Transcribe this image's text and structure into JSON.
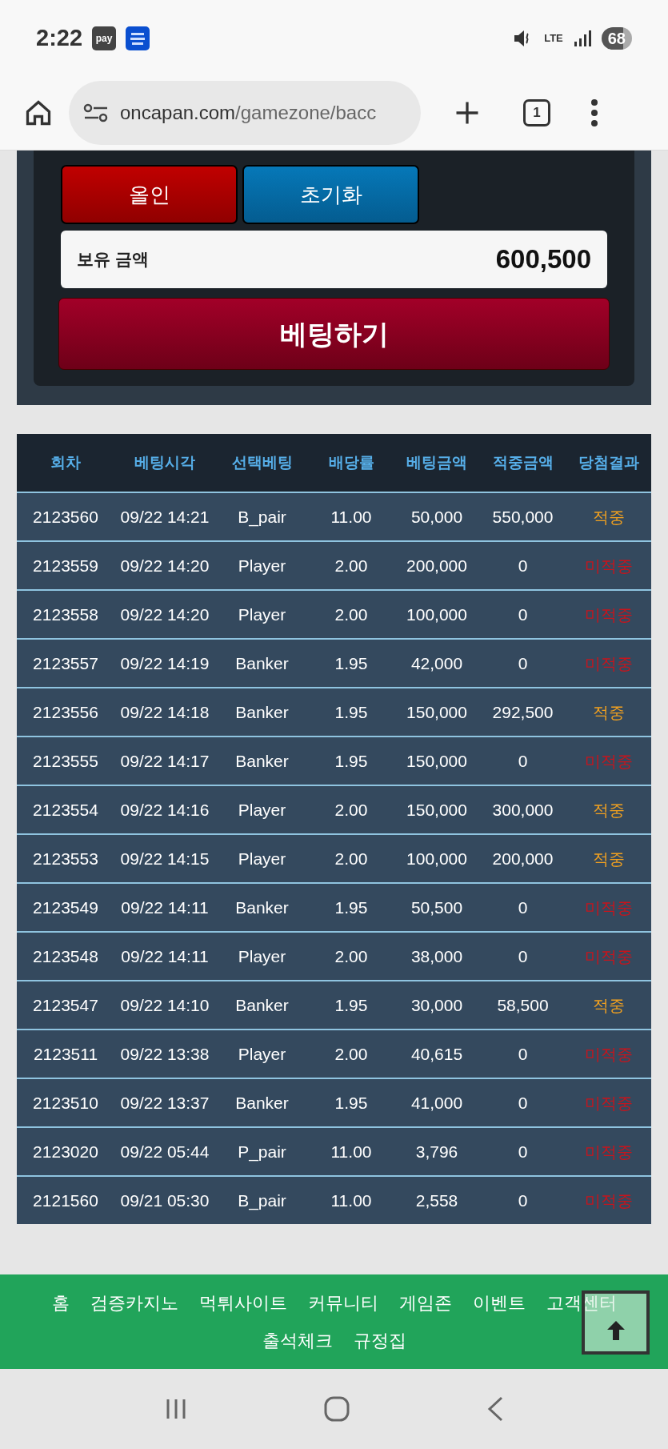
{
  "status_bar": {
    "time": "2:22",
    "pay_badge": "pay",
    "network": "LTE",
    "battery": "68"
  },
  "browser": {
    "domain": "oncapan.com",
    "path": "/gamezone/bacc",
    "tab_count": "1"
  },
  "bet_panel": {
    "all_in_button": "올인",
    "reset_button": "초기화",
    "balance_label": "보유 금액",
    "balance_value": "600,500",
    "bet_button": "베팅하기"
  },
  "table": {
    "columns": [
      "회차",
      "베팅시각",
      "선택베팅",
      "배당률",
      "베팅금액",
      "적중금액",
      "당첨결과"
    ],
    "rows": [
      {
        "cells": [
          "2123560",
          "09/22 14:21",
          "B_pair",
          "11.00",
          "50,000",
          "550,000"
        ],
        "result": "적중",
        "won": true
      },
      {
        "cells": [
          "2123559",
          "09/22 14:20",
          "Player",
          "2.00",
          "200,000",
          "0"
        ],
        "result": "미적중",
        "won": false
      },
      {
        "cells": [
          "2123558",
          "09/22 14:20",
          "Player",
          "2.00",
          "100,000",
          "0"
        ],
        "result": "미적중",
        "won": false
      },
      {
        "cells": [
          "2123557",
          "09/22 14:19",
          "Banker",
          "1.95",
          "42,000",
          "0"
        ],
        "result": "미적중",
        "won": false
      },
      {
        "cells": [
          "2123556",
          "09/22 14:18",
          "Banker",
          "1.95",
          "150,000",
          "292,500"
        ],
        "result": "적중",
        "won": true
      },
      {
        "cells": [
          "2123555",
          "09/22 14:17",
          "Banker",
          "1.95",
          "150,000",
          "0"
        ],
        "result": "미적중",
        "won": false
      },
      {
        "cells": [
          "2123554",
          "09/22 14:16",
          "Player",
          "2.00",
          "150,000",
          "300,000"
        ],
        "result": "적중",
        "won": true
      },
      {
        "cells": [
          "2123553",
          "09/22 14:15",
          "Player",
          "2.00",
          "100,000",
          "200,000"
        ],
        "result": "적중",
        "won": true
      },
      {
        "cells": [
          "2123549",
          "09/22 14:11",
          "Banker",
          "1.95",
          "50,500",
          "0"
        ],
        "result": "미적중",
        "won": false
      },
      {
        "cells": [
          "2123548",
          "09/22 14:11",
          "Player",
          "2.00",
          "38,000",
          "0"
        ],
        "result": "미적중",
        "won": false
      },
      {
        "cells": [
          "2123547",
          "09/22 14:10",
          "Banker",
          "1.95",
          "30,000",
          "58,500"
        ],
        "result": "적중",
        "won": true
      },
      {
        "cells": [
          "2123511",
          "09/22 13:38",
          "Player",
          "2.00",
          "40,615",
          "0"
        ],
        "result": "미적중",
        "won": false
      },
      {
        "cells": [
          "2123510",
          "09/22 13:37",
          "Banker",
          "1.95",
          "41,000",
          "0"
        ],
        "result": "미적중",
        "won": false
      },
      {
        "cells": [
          "2123020",
          "09/22 05:44",
          "P_pair",
          "11.00",
          "3,796",
          "0"
        ],
        "result": "미적중",
        "won": false
      },
      {
        "cells": [
          "2121560",
          "09/21 05:30",
          "B_pair",
          "11.00",
          "2,558",
          "0"
        ],
        "result": "미적중",
        "won": false
      }
    ]
  },
  "footer_links": [
    "홈",
    "검증카지노",
    "먹튀사이트",
    "커뮤니티",
    "게임존",
    "이벤트",
    "고객센터",
    "출석체크",
    "규정집"
  ]
}
